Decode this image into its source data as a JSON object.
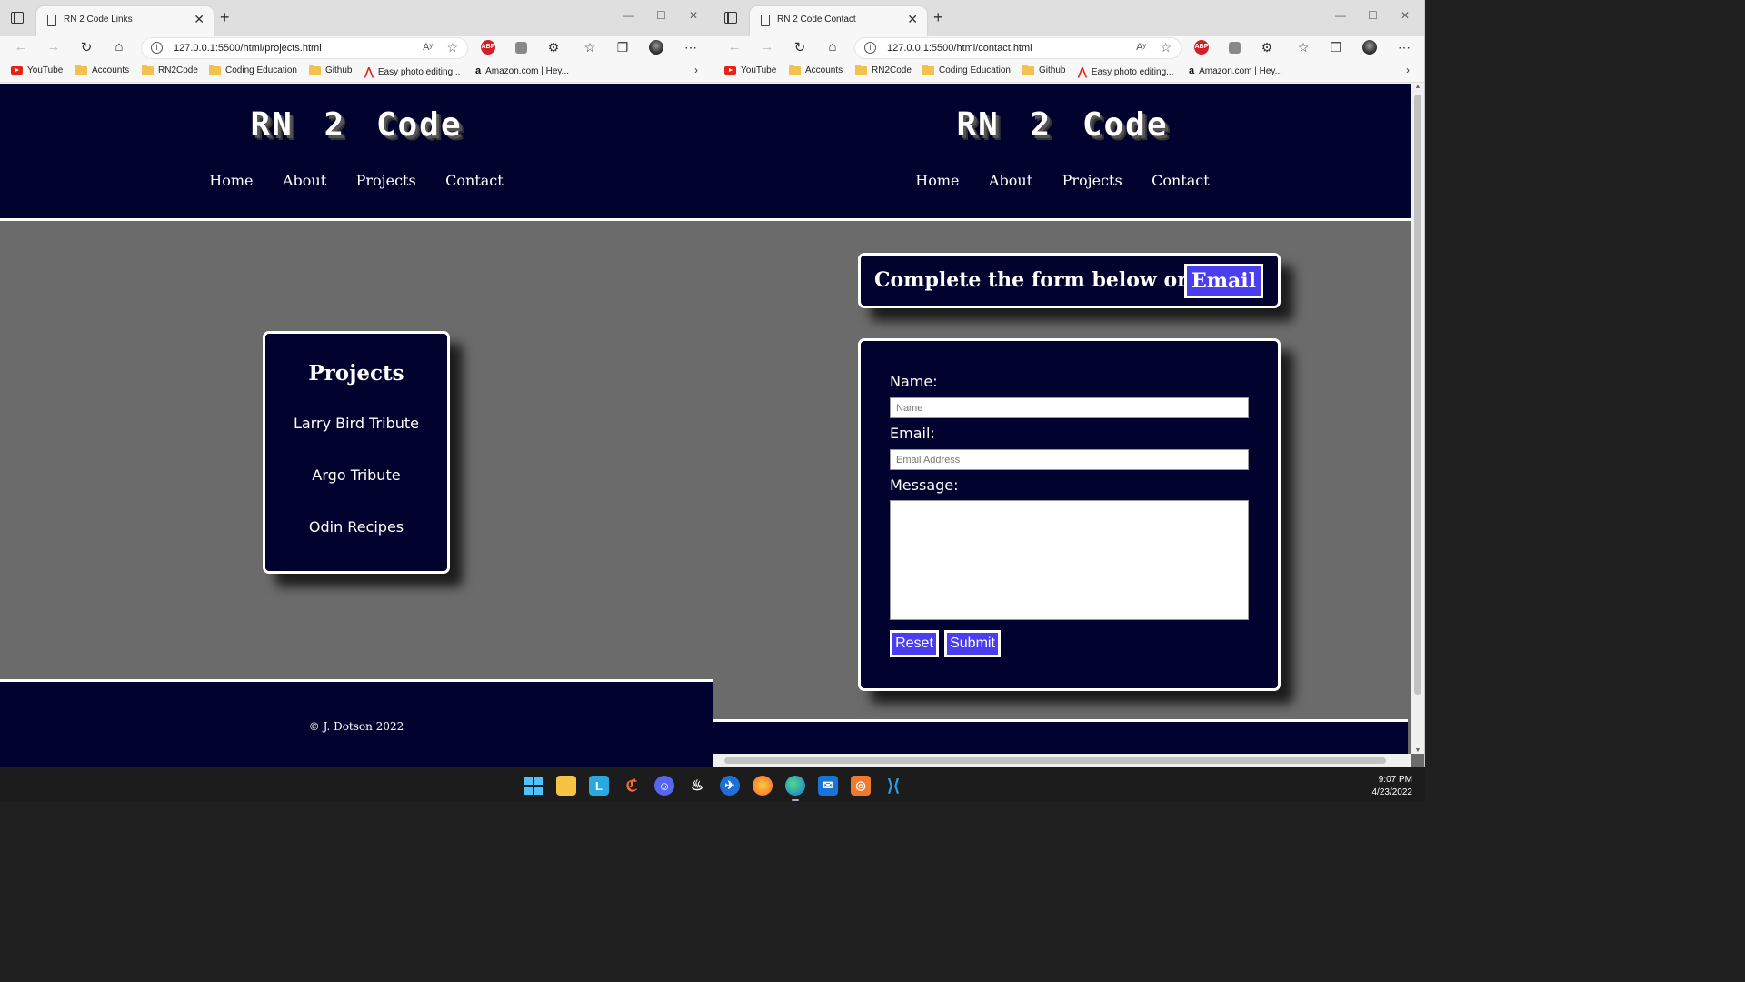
{
  "left_window": {
    "tab_title": "RN 2 Code Links",
    "url": "127.0.0.1:5500/html/projects.html",
    "page": {
      "logo": "RN 2 Code",
      "nav": [
        "Home",
        "About",
        "Projects",
        "Contact"
      ],
      "projects_heading": "Projects",
      "projects": [
        "Larry Bird Tribute",
        "Argo Tribute",
        "Odin Recipes"
      ],
      "footer": "© J. Dotson 2022"
    }
  },
  "right_window": {
    "tab_title": "RN 2 Code Contact",
    "url": "127.0.0.1:5500/html/contact.html",
    "page": {
      "logo": "RN 2 Code",
      "nav": [
        "Home",
        "About",
        "Projects",
        "Contact"
      ],
      "cta_text": "Complete the form below or",
      "cta_email": "Email",
      "form": {
        "name_label": "Name:",
        "name_placeholder": "Name",
        "email_label": "Email:",
        "email_placeholder": "Email Address",
        "message_label": "Message:",
        "reset_label": "Reset",
        "submit_label": "Submit"
      }
    }
  },
  "bookmarks": [
    "YouTube",
    "Accounts",
    "RN2Code",
    "Coding Education",
    "Github",
    "Easy photo editing...",
    "Amazon.com | Hey..."
  ],
  "read_aloud": "Aʸ",
  "taskbar": {
    "time": "9:07 PM",
    "date": "4/23/2022"
  },
  "colors": {
    "site_navy": "#02022e",
    "button_blue": "#4a3ef0",
    "page_gray": "#6b6b6b"
  }
}
